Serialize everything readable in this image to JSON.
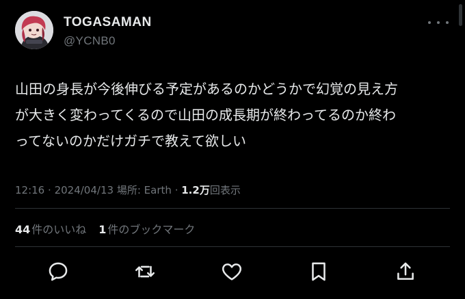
{
  "user": {
    "display_name": "TOGASAMAN",
    "handle": "@YCNB0"
  },
  "tweet": {
    "lines": [
      "山田の身長が今後伸びる予定があるのかどうかで幻覚の見え方",
      "が大きく変わってくるので山田の成長期が終わってるのか終わ",
      "ってないのかだけガチで教えて欲しい"
    ]
  },
  "meta": {
    "time": "12:16",
    "separator": "·",
    "date": "2024/04/13",
    "location_label": "場所:",
    "location": "Earth",
    "views_count": "1.2万",
    "views_label": "回表示"
  },
  "stats": {
    "likes_count": "44",
    "likes_label": "件のいいね",
    "bookmarks_count": "1",
    "bookmarks_label": "件のブックマーク"
  },
  "icons": {
    "more": "more-horizontal-icon",
    "reply": "reply-icon",
    "retweet": "retweet-icon",
    "like": "heart-icon",
    "bookmark": "bookmark-icon",
    "share": "share-icon"
  },
  "colors": {
    "background": "#000000",
    "primary_text": "#e7e9ea",
    "secondary_text": "#71767b",
    "divider": "#2f3336"
  }
}
